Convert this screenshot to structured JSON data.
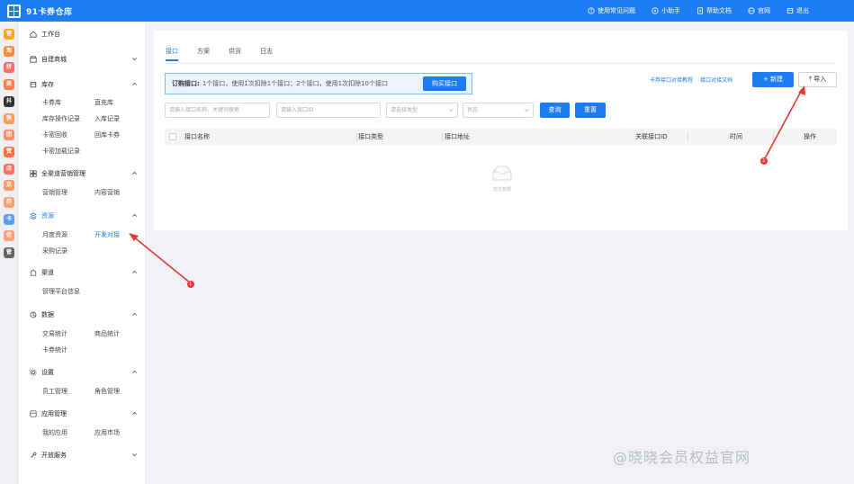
{
  "app": {
    "title": "91卡券仓库"
  },
  "topnav": [
    {
      "label": "使用常见问题",
      "icon": "help-icon"
    },
    {
      "label": "小助手",
      "icon": "assistant-icon"
    },
    {
      "label": "帮助文档",
      "icon": "doc-icon"
    },
    {
      "label": "官网",
      "icon": "globe-icon"
    },
    {
      "label": "退出",
      "icon": "exit-icon"
    }
  ],
  "rail": [
    {
      "label": "营",
      "color": "#f5a623"
    },
    {
      "label": "淘",
      "color": "#ff8a3d"
    },
    {
      "label": "拼",
      "color": "#ff6b6b"
    },
    {
      "label": "美",
      "color": "#ff7f50"
    },
    {
      "label": "抖",
      "color": "#333333"
    },
    {
      "label": "快",
      "color": "#ff9a5a"
    },
    {
      "label": "团",
      "color": "#ff8c69"
    },
    {
      "label": "赞",
      "color": "#ff7043"
    },
    {
      "label": "店",
      "color": "#ff6f61"
    },
    {
      "label": "京",
      "color": "#ff9966"
    },
    {
      "label": "券",
      "color": "#ff9f6e"
    },
    {
      "label": "卡",
      "color": "#5b9bf0"
    },
    {
      "label": "优",
      "color": "#ffa07a"
    },
    {
      "label": "管",
      "color": "#666666"
    }
  ],
  "sidebar": {
    "workspace": "工作台",
    "mall": "自建商城",
    "inventory": {
      "label": "库存",
      "items": [
        "卡券库",
        "直充库",
        "库存操作记录",
        "入库记录",
        "卡密回收",
        "回库卡券",
        "卡密加载记录"
      ]
    },
    "marketing": {
      "label": "全渠道营销管理",
      "items": [
        "营销管理",
        "内容营销"
      ]
    },
    "resources": {
      "label": "资源",
      "items": [
        "月度资源",
        "开发对接",
        "采购记录"
      ]
    },
    "supply": {
      "label": "渠道",
      "items": [
        "管理平台信息"
      ]
    },
    "data": {
      "label": "数据",
      "items": [
        "交易统计",
        "商品统计",
        "卡券统计"
      ]
    },
    "settings": {
      "label": "设置",
      "items": [
        "员工管理",
        "角色管理"
      ]
    },
    "apps": {
      "label": "应用管理",
      "items": [
        "我的应用",
        "应用市场"
      ]
    },
    "open": {
      "label": "开放服务"
    }
  },
  "main": {
    "tabs": [
      "接口",
      "方案",
      "供货",
      "日志"
    ],
    "notice": {
      "lead": "订购接口:",
      "text": "1个接口，使用1次扣除1个接口；2个接口，使用1次扣除10个接口",
      "buy": "购买接口"
    },
    "links": [
      "卡券接口对接教程",
      "接口对接文档"
    ],
    "new_button": "新建",
    "import_button": "导入",
    "filters": {
      "name_placeholder": "请输入接口名称、关键词搜索",
      "id_placeholder": "请输入接口ID",
      "type_placeholder": "请选择类型",
      "status_placeholder": "状态"
    },
    "search_button": "查询",
    "reset_button": "重置",
    "columns": [
      "接口名称",
      "接口类型",
      "接口地址",
      "关联接口ID",
      "时间",
      "操作"
    ],
    "empty": "暂无数据"
  },
  "annotations": [
    "1",
    "2"
  ],
  "watermark": "@晓晓会员权益官网",
  "colors": {
    "primary": "#1e7cf2",
    "annotation": "#e53935"
  }
}
